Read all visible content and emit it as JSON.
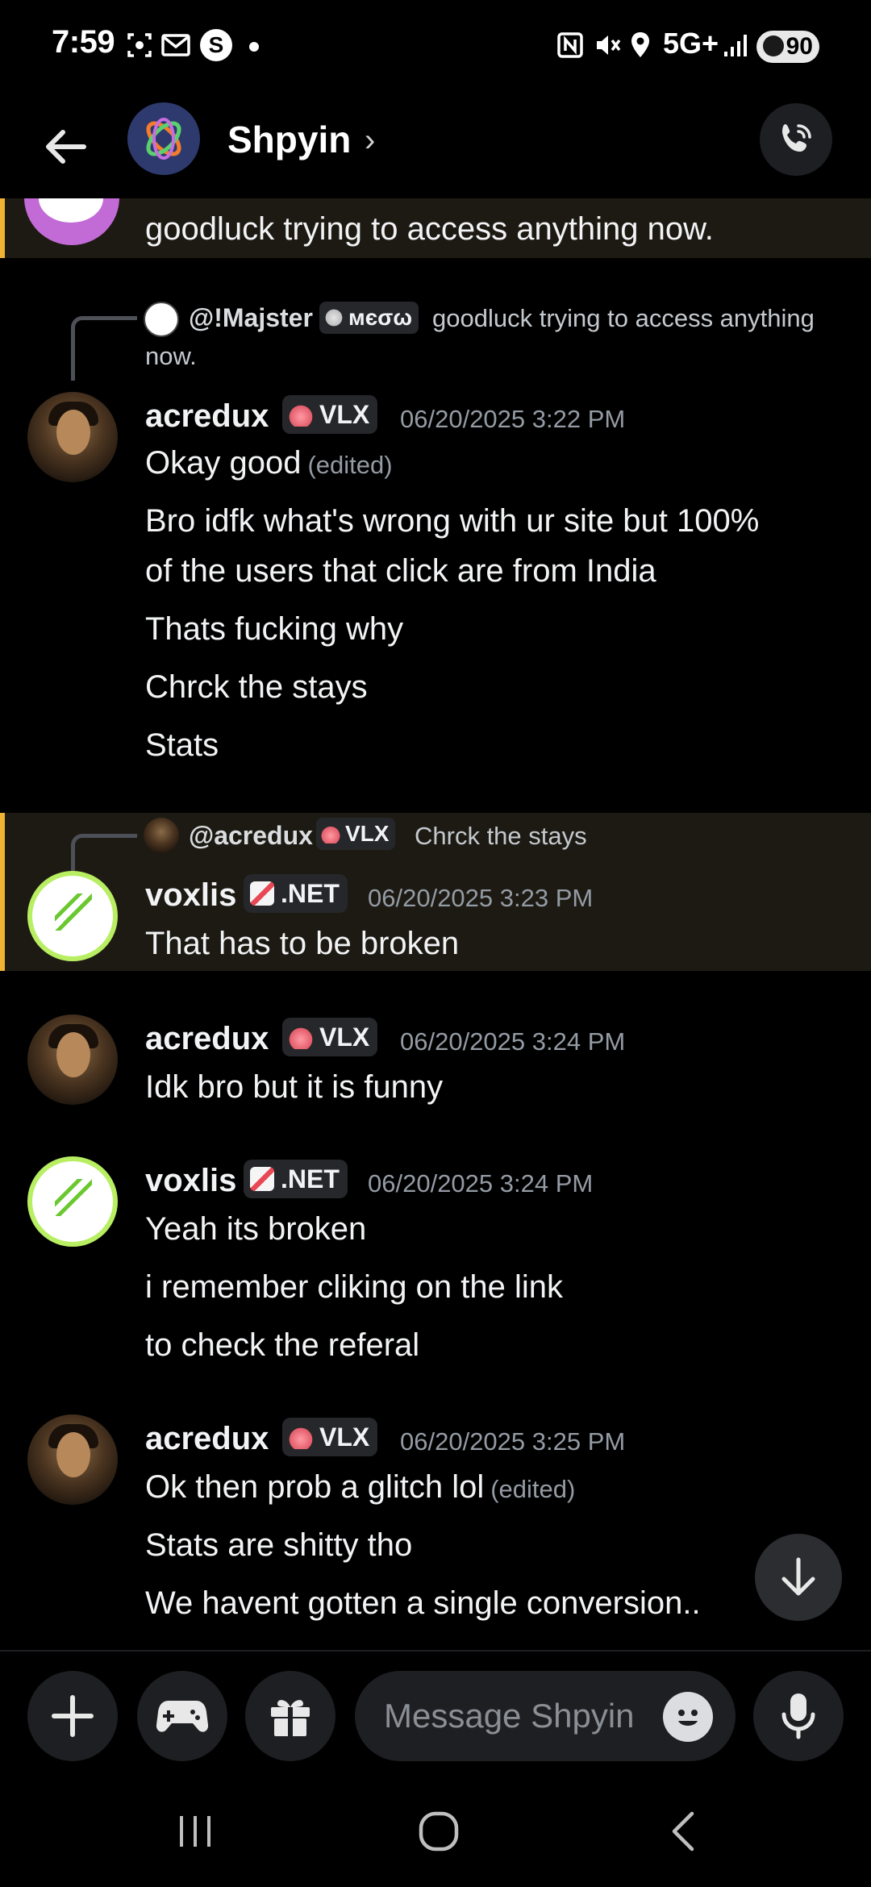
{
  "status_bar": {
    "time": "7:59",
    "notification_letter": "S",
    "network": "5G+",
    "battery": "90"
  },
  "header": {
    "title": "Shpyin",
    "chevron": "›"
  },
  "top_fragment": {
    "text": "goodluck trying to access anything now."
  },
  "messages": [
    {
      "reply": {
        "name": "@!Majster",
        "tag": "мєσω",
        "text_line1": "goodluck trying to access anything",
        "text_line2": "now."
      },
      "author": "acredux",
      "tag": "VLX",
      "time": "06/20/2025 3:22 PM",
      "lines": [
        {
          "text": "Okay good",
          "edited": "(edited)"
        },
        {
          "text": "Bro idfk what's wrong with ur site but 100%"
        },
        {
          "text": "of the users that click are from India"
        },
        {
          "text": "Thats fucking why"
        },
        {
          "text": "Chrck the stays"
        },
        {
          "text": "Stats"
        }
      ]
    },
    {
      "reply": {
        "name": "@acredux",
        "tag": "VLX",
        "text_line1": "Chrck the stays"
      },
      "author": "voxlis",
      "tag": ".NET",
      "time": "06/20/2025 3:23 PM",
      "lines": [
        {
          "text": "That has to be broken"
        }
      ]
    },
    {
      "author": "acredux",
      "tag": "VLX",
      "time": "06/20/2025 3:24 PM",
      "lines": [
        {
          "text": "Idk bro but it is funny"
        }
      ]
    },
    {
      "author": "voxlis",
      "tag": ".NET",
      "time": "06/20/2025 3:24 PM",
      "lines": [
        {
          "text": "Yeah its broken"
        },
        {
          "text": "i remember cliking on the link"
        },
        {
          "text": "to check the referal"
        }
      ]
    },
    {
      "author": "acredux",
      "tag": "VLX",
      "time": "06/20/2025 3:25 PM",
      "lines": [
        {
          "text": "Ok then prob a glitch lol",
          "edited": "(edited)"
        },
        {
          "text": "Stats are shitty tho"
        },
        {
          "text": "We havent gotten a single conversion.."
        }
      ]
    }
  ],
  "composer": {
    "placeholder": "Message Shpyin"
  },
  "colors": {
    "background": "#000000",
    "mention_highlight": "#1d1a13",
    "mention_bar": "#f0b232",
    "muted_text": "#949ba4",
    "button_bg": "#1e1f22"
  },
  "icons": [
    "back-arrow-icon",
    "call-icon",
    "plus-icon",
    "gamepad-icon",
    "gift-icon",
    "emoji-icon",
    "mic-icon",
    "arrow-down-icon",
    "recents-icon",
    "home-icon",
    "nav-back-icon"
  ]
}
